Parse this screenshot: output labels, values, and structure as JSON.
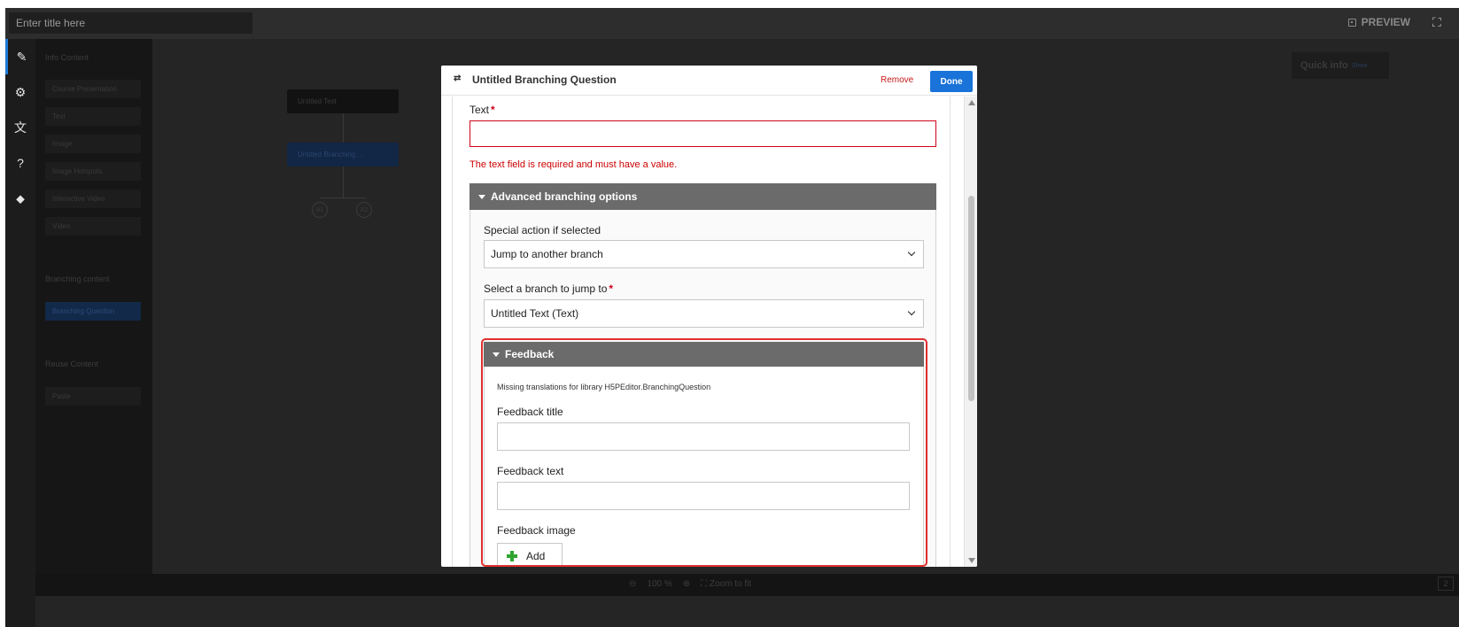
{
  "topbar": {
    "title_placeholder": "Enter title here",
    "preview_label": "PREVIEW"
  },
  "rail": {
    "items": [
      "edit-icon",
      "gear-icon",
      "translate-icon",
      "help-icon",
      "tag-icon"
    ]
  },
  "panel": {
    "info_content_label": "Info Content",
    "info_items": [
      "Course Presentation",
      "Text",
      "Image",
      "Image Hotspots",
      "Interactive Video",
      "Video"
    ],
    "branching_content_label": "Branching content",
    "branching_items": [
      "Branching Question"
    ],
    "reuse_content_label": "Reuse Content",
    "reuse_items": [
      "Paste"
    ]
  },
  "canvas": {
    "node_text": "Untitled Text",
    "node_branching": "Untitled Branching ...",
    "alt1": "A1",
    "alt2": "A2",
    "quick_info": "Quick info",
    "quick_info_show": "Show"
  },
  "bottombar": {
    "zoom_level": "100 %",
    "zoom_to_fit": "Zoom to fit",
    "page_indicator": "2"
  },
  "modal": {
    "title": "Untitled Branching Question",
    "remove_label": "Remove",
    "done_label": "Done",
    "text_label": "Text",
    "required_mark": "*",
    "text_error": "The text field is required and must have a value.",
    "advanced_header": "Advanced branching options",
    "special_action_label": "Special action if selected",
    "special_action_value": "Jump to another branch",
    "branch_label": "Select a branch to jump to",
    "branch_value": "Untitled Text (Text)",
    "feedback_header": "Feedback",
    "missing_translations": "Missing translations for library H5PEditor.BranchingQuestion",
    "feedback_title_label": "Feedback title",
    "feedback_text_label": "Feedback text",
    "feedback_image_label": "Feedback image",
    "add_label": "Add"
  },
  "colors": {
    "accent": "#1a73d9",
    "error": "#d0021b",
    "highlight_outline": "#e0302f",
    "header_gray": "#6b6b6b",
    "add_green": "#2fa52f"
  }
}
